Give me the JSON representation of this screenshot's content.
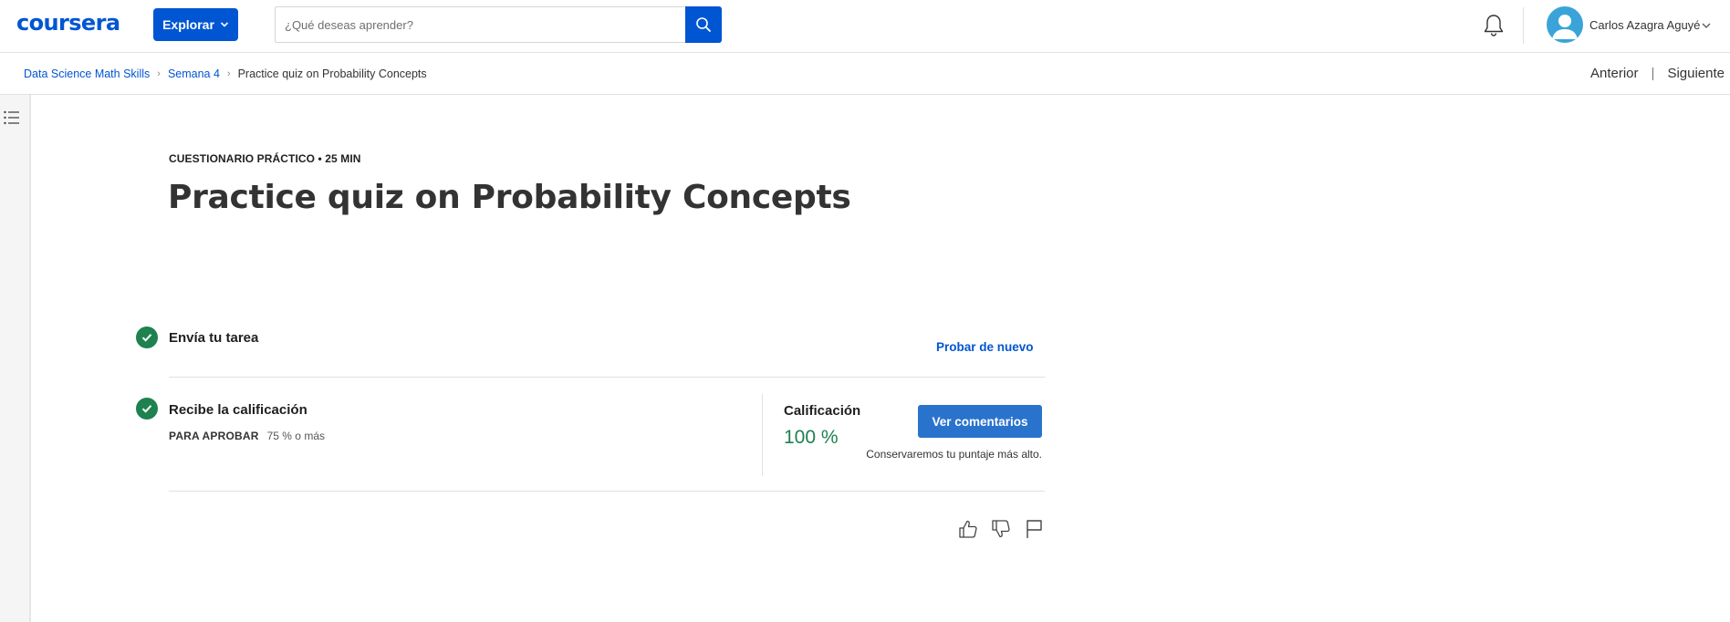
{
  "header": {
    "logo": "coursera",
    "explore_label": "Explorar",
    "search_placeholder": "¿Qué deseas aprender?",
    "user_name": "Carlos Azagra Aguyé"
  },
  "breadcrumb": {
    "items": [
      "Data Science Math Skills",
      "Semana 4"
    ],
    "current": "Practice quiz on Probability Concepts"
  },
  "nav": {
    "prev": "Anterior",
    "divider": "|",
    "next": "Siguiente"
  },
  "quiz": {
    "eyebrow": "CUESTIONARIO PRÁCTICO • 25 MIN",
    "title": "Practice quiz on Probability Concepts",
    "submit_step": "Envía tu tarea",
    "retry_label": "Probar de nuevo",
    "grade_step": "Recibe la calificación",
    "pass_label": "PARA APROBAR",
    "pass_value": "75 % o más",
    "grade_label": "Calificación",
    "grade_value": "100 %",
    "feedback_button": "Ver comentarios",
    "keep_note": "Conservaremos tu puntaje más alto."
  },
  "colors": {
    "brand_blue": "#0056d2",
    "success_green": "#1e8150"
  },
  "icons": [
    "search-icon",
    "bell-icon",
    "user-avatar-icon",
    "chevron-down-icon",
    "toc-list-icon",
    "check-circle-icon",
    "thumbs-up-icon",
    "thumbs-down-icon",
    "flag-icon"
  ]
}
